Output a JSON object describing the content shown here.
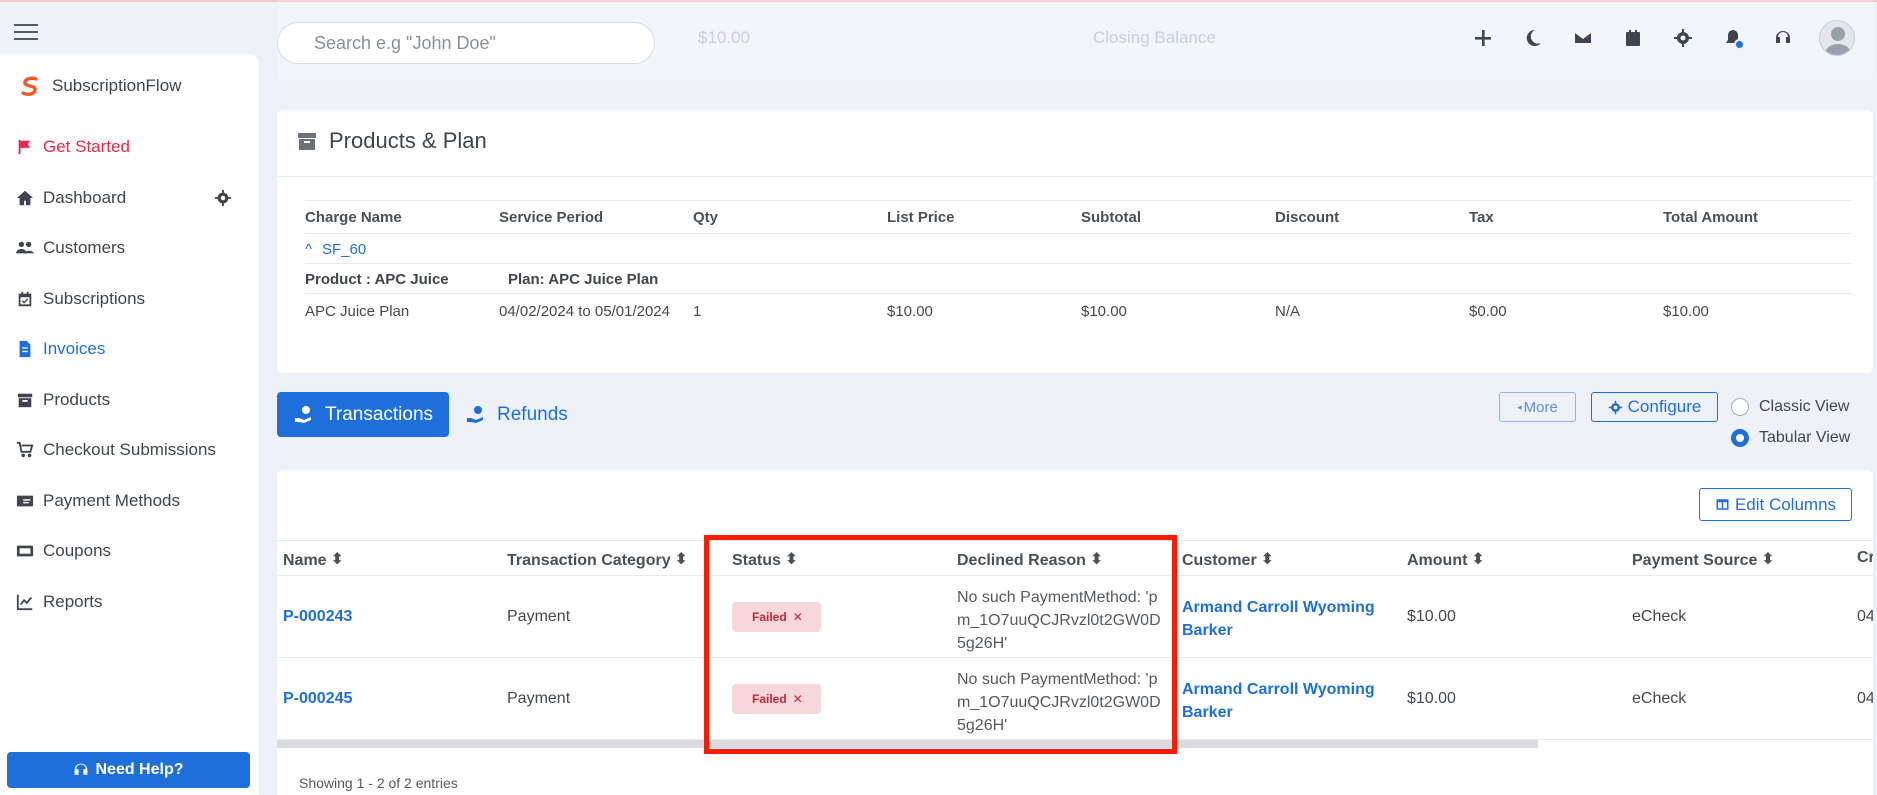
{
  "header": {
    "search_placeholder": "Search e.g \"John Doe\"",
    "ghost_amount": "$10.00",
    "ghost_closing": "Closing Balance",
    "icons": [
      "plus-icon",
      "moon-icon",
      "mail-icon",
      "calendar-icon",
      "gear-icon",
      "bell-icon",
      "headset-icon",
      "avatar"
    ]
  },
  "sidebar": {
    "brand": "SubscriptionFlow",
    "items": [
      {
        "label": "Get Started",
        "icon": "flag-icon"
      },
      {
        "label": "Dashboard",
        "icon": "home-icon"
      },
      {
        "label": "Customers",
        "icon": "users-icon"
      },
      {
        "label": "Subscriptions",
        "icon": "calendar-check-icon"
      },
      {
        "label": "Invoices",
        "icon": "invoice-icon"
      },
      {
        "label": "Products",
        "icon": "archive-icon"
      },
      {
        "label": "Checkout Submissions",
        "icon": "cart-icon"
      },
      {
        "label": "Payment Methods",
        "icon": "money-icon"
      },
      {
        "label": "Coupons",
        "icon": "ticket-icon"
      },
      {
        "label": "Reports",
        "icon": "chart-icon"
      }
    ],
    "help": "Need Help?"
  },
  "products": {
    "title": "Products & Plan",
    "columns": [
      "Charge Name",
      "Service Period",
      "Qty",
      "List Price",
      "Subtotal",
      "Discount",
      "Tax",
      "Total Amount"
    ],
    "group": "SF_60",
    "product_label": "Product : APC Juice",
    "plan_label": "Plan: APC Juice Plan",
    "row": [
      "APC Juice Plan",
      "04/02/2024 to 05/01/2024",
      "1",
      "$10.00",
      "$10.00",
      "N/A",
      "$0.00",
      "$10.00"
    ]
  },
  "tabs": {
    "transactions": "Transactions",
    "refunds": "Refunds",
    "more": "More",
    "configure": "Configure",
    "classic_view": "Classic View",
    "tabular_view": "Tabular View"
  },
  "transactions": {
    "edit_columns": "Edit Columns",
    "columns": [
      "Name",
      "Transaction Category",
      "Status",
      "Declined Reason",
      "Customer",
      "Amount",
      "Payment Source",
      "Cr"
    ],
    "rows": [
      {
        "name": "P-000243",
        "category": "Payment",
        "status": "Failed",
        "reason": "No such PaymentMethod: 'pm_1O7uuQCJRvzl0t2GW0D5g26H'",
        "customer": "Armand Carroll Wyoming Barker",
        "amount": "$10.00",
        "source": "eCheck",
        "created": "04"
      },
      {
        "name": "P-000245",
        "category": "Payment",
        "status": "Failed",
        "reason": "No such PaymentMethod: 'pm_1O7uuQCJRvzl0t2GW0D5g26H'",
        "customer": "Armand Carroll Wyoming Barker",
        "amount": "$10.00",
        "source": "eCheck",
        "created": "04"
      }
    ],
    "showing": "Showing 1 - 2 of 2 entries"
  },
  "colors": {
    "accent": "#1e6fd9",
    "danger": "#e5294b",
    "highlight": "#ff1a00"
  }
}
